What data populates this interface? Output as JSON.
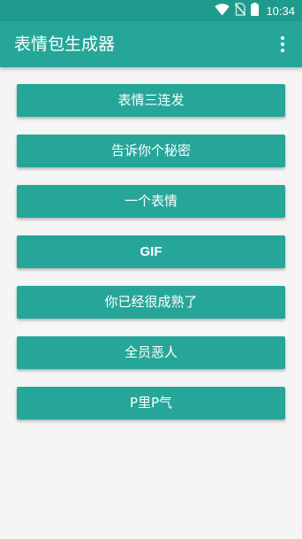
{
  "status_bar": {
    "time": "10:34",
    "icons": [
      "wifi-icon",
      "no-sim-icon",
      "battery-icon"
    ],
    "color": "#1e9b8d"
  },
  "app_bar": {
    "title": "表情包生成器",
    "menu_icon": "more-vert-icon",
    "color": "#26a699"
  },
  "buttons": [
    {
      "label": "表情三连发"
    },
    {
      "label": "告诉你个秘密"
    },
    {
      "label": "一个表情"
    },
    {
      "label": "GIF"
    },
    {
      "label": "你已经很成熟了"
    },
    {
      "label": "全员恶人"
    },
    {
      "label": "P里P气"
    }
  ],
  "colors": {
    "accent": "#26a699",
    "background": "#f5f5f5",
    "text_on_accent": "#ffffff"
  }
}
